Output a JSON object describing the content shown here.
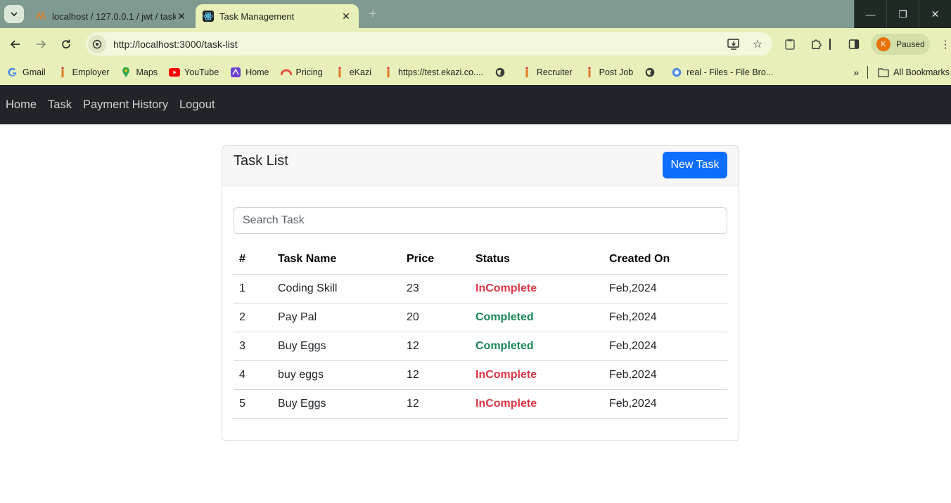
{
  "browser": {
    "tabs": [
      {
        "title": "localhost / 127.0.0.1 / jwt / task",
        "icon": "phpmyadmin-icon",
        "active": false
      },
      {
        "title": "Task Management",
        "icon": "react-icon",
        "active": true
      }
    ],
    "url": "http://localhost:3000/task-list",
    "profile_initial": "K",
    "profile_status": "Paused",
    "bookmarks": [
      {
        "label": "Gmail",
        "icon": "google-icon"
      },
      {
        "label": "Employer",
        "icon": "ekazi-icon"
      },
      {
        "label": "Maps",
        "icon": "maps-icon"
      },
      {
        "label": "YouTube",
        "icon": "youtube-icon"
      },
      {
        "label": "Home",
        "icon": "home-app-icon"
      },
      {
        "label": "Pricing",
        "icon": "pricing-icon"
      },
      {
        "label": "eKazi",
        "icon": "ekazi-icon"
      },
      {
        "label": "https://test.ekazi.co....",
        "icon": "ekazi-icon"
      },
      {
        "label": "",
        "icon": "globe-icon"
      },
      {
        "label": "Recruiter",
        "icon": "ekazi-icon"
      },
      {
        "label": "Post Job",
        "icon": "ekazi-icon"
      },
      {
        "label": "",
        "icon": "globe-icon"
      },
      {
        "label": "real - Files - File Bro...",
        "icon": "file-browser-icon"
      }
    ],
    "all_bookmarks": "All Bookmarks"
  },
  "nav": {
    "items": [
      "Home",
      "Task",
      "Payment History",
      "Logout"
    ]
  },
  "card": {
    "title": "Task List",
    "new_task_label": "New Task",
    "search_placeholder": "Search Task"
  },
  "table": {
    "headers": [
      "#",
      "Task Name",
      "Price",
      "Status",
      "Created On"
    ],
    "rows": [
      {
        "num": "1",
        "name": "Coding Skill",
        "price": "23",
        "status": "InComplete",
        "created": "Feb,2024"
      },
      {
        "num": "2",
        "name": "Pay Pal",
        "price": "20",
        "status": "Completed",
        "created": "Feb,2024"
      },
      {
        "num": "3",
        "name": "Buy Eggs",
        "price": "12",
        "status": "Completed",
        "created": "Feb,2024"
      },
      {
        "num": "4",
        "name": "buy eggs",
        "price": "12",
        "status": "InComplete",
        "created": "Feb,2024"
      },
      {
        "num": "5",
        "name": "Buy Eggs",
        "price": "12",
        "status": "InComplete",
        "created": "Feb,2024"
      }
    ]
  },
  "colors": {
    "navbar_bg": "#212529",
    "primary": "#0d6efd",
    "status_incomplete": "#dc3545",
    "status_completed": "#198754"
  }
}
